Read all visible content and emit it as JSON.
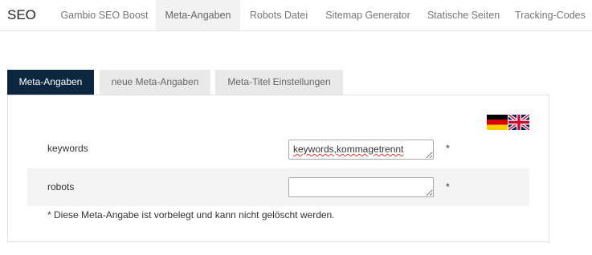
{
  "header": {
    "title": "SEO",
    "nav": [
      {
        "label": "Gambio SEO Boost"
      },
      {
        "label": "Meta-Angaben"
      },
      {
        "label": "Robots Datei"
      },
      {
        "label": "Sitemap Generator"
      },
      {
        "label": "Statische Seiten"
      },
      {
        "label": "Tracking-Codes"
      }
    ]
  },
  "tabs": [
    {
      "label": "Meta-Angaben"
    },
    {
      "label": "neue Meta-Angaben"
    },
    {
      "label": "Meta-Titel Einstellungen"
    }
  ],
  "languages": [
    "de-flag-icon",
    "gb-flag-icon"
  ],
  "fields": [
    {
      "label": "keywords",
      "value": "keywords,kommagetrennt",
      "required_mark": "*"
    },
    {
      "label": "robots",
      "value": "",
      "required_mark": "*"
    }
  ],
  "note": "* Diese Meta-Angabe ist vorbelegt und kann nicht gelöscht werden.",
  "colors": {
    "active_tab": "#0b2740",
    "inactive_tab": "#e9e9e9",
    "active_nav": "#f2f2f2"
  }
}
